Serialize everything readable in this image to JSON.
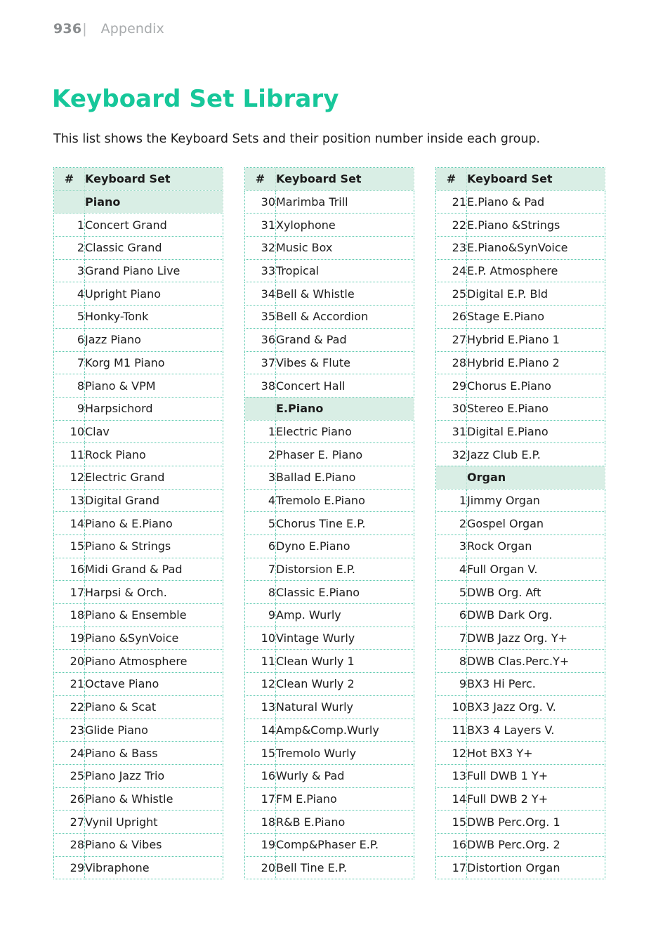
{
  "running_head": {
    "page_number": "936",
    "separator": "|",
    "section": "Appendix"
  },
  "title": "Keyboard Set Library",
  "intro": "This list shows the Keyboard Sets and their position number inside each group.",
  "colors": {
    "title_teal": "#17c79a",
    "header_fill": "#d9eee5",
    "grid_dotted": "#59c8ad",
    "text": "#1c1c1c",
    "runhead_gray": "#a8abad"
  },
  "table_headers": {
    "num": "#",
    "name": "Keyboard Set"
  },
  "columns": [
    {
      "rows": [
        {
          "type": "header",
          "num": "#",
          "name": "Keyboard Set"
        },
        {
          "type": "group",
          "num": "",
          "name": "Piano"
        },
        {
          "type": "item",
          "num": "1",
          "name": "Concert Grand"
        },
        {
          "type": "item",
          "num": "2",
          "name": "Classic Grand"
        },
        {
          "type": "item",
          "num": "3",
          "name": "Grand Piano Live"
        },
        {
          "type": "item",
          "num": "4",
          "name": "Upright Piano"
        },
        {
          "type": "item",
          "num": "5",
          "name": "Honky-Tonk"
        },
        {
          "type": "item",
          "num": "6",
          "name": "Jazz Piano"
        },
        {
          "type": "item",
          "num": "7",
          "name": "Korg M1 Piano"
        },
        {
          "type": "item",
          "num": "8",
          "name": "Piano & VPM"
        },
        {
          "type": "item",
          "num": "9",
          "name": "Harpsichord"
        },
        {
          "type": "item",
          "num": "10",
          "name": "Clav"
        },
        {
          "type": "item",
          "num": "11",
          "name": "Rock Piano"
        },
        {
          "type": "item",
          "num": "12",
          "name": "Electric Grand"
        },
        {
          "type": "item",
          "num": "13",
          "name": "Digital Grand"
        },
        {
          "type": "item",
          "num": "14",
          "name": "Piano & E.Piano"
        },
        {
          "type": "item",
          "num": "15",
          "name": "Piano & Strings"
        },
        {
          "type": "item",
          "num": "16",
          "name": "Midi Grand & Pad"
        },
        {
          "type": "item",
          "num": "17",
          "name": "Harpsi & Orch."
        },
        {
          "type": "item",
          "num": "18",
          "name": "Piano & Ensemble"
        },
        {
          "type": "item",
          "num": "19",
          "name": "Piano &SynVoice"
        },
        {
          "type": "item",
          "num": "20",
          "name": "Piano Atmosphere"
        },
        {
          "type": "item",
          "num": "21",
          "name": "Octave Piano"
        },
        {
          "type": "item",
          "num": "22",
          "name": "Piano & Scat"
        },
        {
          "type": "item",
          "num": "23",
          "name": "Glide Piano"
        },
        {
          "type": "item",
          "num": "24",
          "name": "Piano & Bass"
        },
        {
          "type": "item",
          "num": "25",
          "name": "Piano Jazz Trio"
        },
        {
          "type": "item",
          "num": "26",
          "name": "Piano & Whistle"
        },
        {
          "type": "item",
          "num": "27",
          "name": "Vynil Upright"
        },
        {
          "type": "item",
          "num": "28",
          "name": "Piano & Vibes"
        },
        {
          "type": "item",
          "num": "29",
          "name": "Vibraphone"
        }
      ]
    },
    {
      "rows": [
        {
          "type": "header",
          "num": "#",
          "name": "Keyboard Set"
        },
        {
          "type": "item",
          "num": "30",
          "name": "Marimba Trill"
        },
        {
          "type": "item",
          "num": "31",
          "name": "Xylophone"
        },
        {
          "type": "item",
          "num": "32",
          "name": "Music Box"
        },
        {
          "type": "item",
          "num": "33",
          "name": "Tropical"
        },
        {
          "type": "item",
          "num": "34",
          "name": "Bell & Whistle"
        },
        {
          "type": "item",
          "num": "35",
          "name": "Bell & Accordion"
        },
        {
          "type": "item",
          "num": "36",
          "name": "Grand & Pad"
        },
        {
          "type": "item",
          "num": "37",
          "name": "Vibes & Flute"
        },
        {
          "type": "item",
          "num": "38",
          "name": "Concert Hall"
        },
        {
          "type": "group",
          "num": "",
          "name": "E.Piano"
        },
        {
          "type": "item",
          "num": "1",
          "name": "Electric Piano"
        },
        {
          "type": "item",
          "num": "2",
          "name": "Phaser E. Piano"
        },
        {
          "type": "item",
          "num": "3",
          "name": "Ballad E.Piano"
        },
        {
          "type": "item",
          "num": "4",
          "name": "Tremolo E.Piano"
        },
        {
          "type": "item",
          "num": "5",
          "name": "Chorus Tine E.P."
        },
        {
          "type": "item",
          "num": "6",
          "name": "Dyno E.Piano"
        },
        {
          "type": "item",
          "num": "7",
          "name": "Distorsion E.P."
        },
        {
          "type": "item",
          "num": "8",
          "name": "Classic E.Piano"
        },
        {
          "type": "item",
          "num": "9",
          "name": "Amp. Wurly"
        },
        {
          "type": "item",
          "num": "10",
          "name": "Vintage Wurly"
        },
        {
          "type": "item",
          "num": "11",
          "name": "Clean Wurly 1"
        },
        {
          "type": "item",
          "num": "12",
          "name": "Clean Wurly 2"
        },
        {
          "type": "item",
          "num": "13",
          "name": "Natural Wurly"
        },
        {
          "type": "item",
          "num": "14",
          "name": "Amp&Comp.Wurly"
        },
        {
          "type": "item",
          "num": "15",
          "name": "Tremolo Wurly"
        },
        {
          "type": "item",
          "num": "16",
          "name": "Wurly & Pad"
        },
        {
          "type": "item",
          "num": "17",
          "name": "FM E.Piano"
        },
        {
          "type": "item",
          "num": "18",
          "name": "R&B E.Piano"
        },
        {
          "type": "item",
          "num": "19",
          "name": "Comp&Phaser E.P."
        },
        {
          "type": "item",
          "num": "20",
          "name": "Bell Tine E.P."
        }
      ]
    },
    {
      "rows": [
        {
          "type": "header",
          "num": "#",
          "name": "Keyboard Set"
        },
        {
          "type": "item",
          "num": "21",
          "name": "E.Piano & Pad"
        },
        {
          "type": "item",
          "num": "22",
          "name": "E.Piano &Strings"
        },
        {
          "type": "item",
          "num": "23",
          "name": "E.Piano&SynVoice"
        },
        {
          "type": "item",
          "num": "24",
          "name": "E.P. Atmosphere"
        },
        {
          "type": "item",
          "num": "25",
          "name": "Digital E.P. Bld"
        },
        {
          "type": "item",
          "num": "26",
          "name": "Stage E.Piano"
        },
        {
          "type": "item",
          "num": "27",
          "name": "Hybrid E.Piano 1"
        },
        {
          "type": "item",
          "num": "28",
          "name": "Hybrid E.Piano 2"
        },
        {
          "type": "item",
          "num": "29",
          "name": "Chorus E.Piano"
        },
        {
          "type": "item",
          "num": "30",
          "name": "Stereo E.Piano"
        },
        {
          "type": "item",
          "num": "31",
          "name": "Digital E.Piano"
        },
        {
          "type": "item",
          "num": "32",
          "name": "Jazz Club E.P."
        },
        {
          "type": "group",
          "num": "",
          "name": "Organ"
        },
        {
          "type": "item",
          "num": "1",
          "name": "Jimmy Organ"
        },
        {
          "type": "item",
          "num": "2",
          "name": "Gospel Organ"
        },
        {
          "type": "item",
          "num": "3",
          "name": "Rock Organ"
        },
        {
          "type": "item",
          "num": "4",
          "name": "Full Organ V."
        },
        {
          "type": "item",
          "num": "5",
          "name": "DWB Org. Aft"
        },
        {
          "type": "item",
          "num": "6",
          "name": "DWB Dark Org."
        },
        {
          "type": "item",
          "num": "7",
          "name": "DWB Jazz Org. Y+"
        },
        {
          "type": "item",
          "num": "8",
          "name": "DWB Clas.Perc.Y+"
        },
        {
          "type": "item",
          "num": "9",
          "name": "BX3 Hi Perc."
        },
        {
          "type": "item",
          "num": "10",
          "name": "BX3 Jazz Org. V."
        },
        {
          "type": "item",
          "num": "11",
          "name": "BX3 4 Layers V."
        },
        {
          "type": "item",
          "num": "12",
          "name": "Hot BX3 Y+"
        },
        {
          "type": "item",
          "num": "13",
          "name": "Full DWB 1 Y+"
        },
        {
          "type": "item",
          "num": "14",
          "name": "Full DWB 2 Y+"
        },
        {
          "type": "item",
          "num": "15",
          "name": "DWB Perc.Org. 1"
        },
        {
          "type": "item",
          "num": "16",
          "name": "DWB Perc.Org. 2"
        },
        {
          "type": "item",
          "num": "17",
          "name": "Distortion Organ"
        }
      ]
    }
  ]
}
